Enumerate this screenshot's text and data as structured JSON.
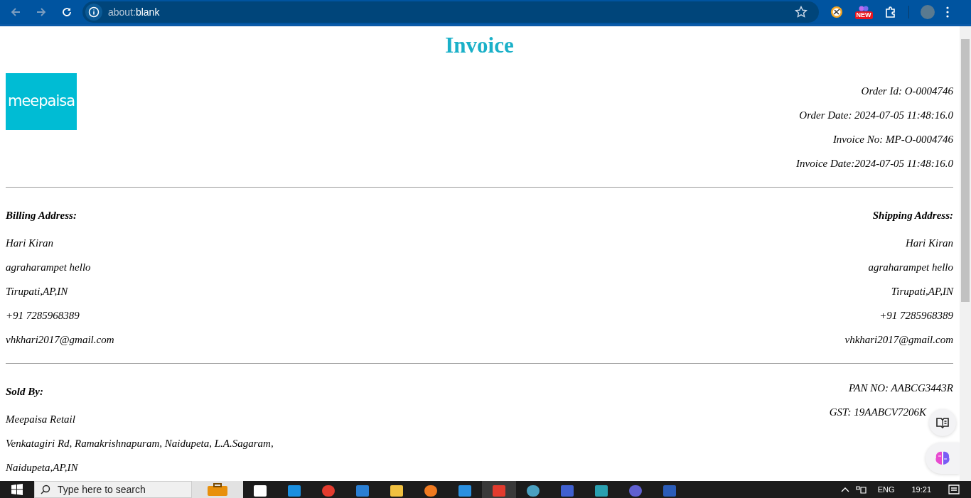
{
  "browser": {
    "url": "about:blank",
    "extension_badge": "NEW"
  },
  "page": {
    "title": "Invoice",
    "logo_text": "meepaisa",
    "order_info": [
      "Order Id: O-0004746",
      "Order Date: 2024-07-05 11:48:16.0",
      "Invoice No: MP-O-0004746",
      "Invoice Date:2024-07-05 11:48:16.0"
    ],
    "billing_address": {
      "heading": "Billing Address:",
      "lines": [
        "Hari Kiran",
        "agraharampet hello",
        "Tirupati,AP,IN",
        "+91 7285968389",
        "vhkhari2017@gmail.com"
      ]
    },
    "shipping_address": {
      "heading": "Shipping Address:",
      "lines": [
        "Hari Kiran",
        "agraharampet hello",
        "Tirupati,AP,IN",
        "+91 7285968389",
        "vhkhari2017@gmail.com"
      ]
    },
    "sold_by": {
      "heading": "Sold By:",
      "lines": [
        "Meepaisa Retail",
        "Venkatagiri Rd, Ramakrishnapuram, Naidupeta, L.A.Sagaram,",
        "Naidupeta,AP,IN"
      ]
    },
    "tax_info": [
      "PAN NO: AABCG3443R",
      "GST: 19AABCV7206K"
    ]
  },
  "taskbar": {
    "search_placeholder": "Type here to search",
    "language": "ENG",
    "time": "19:21"
  }
}
